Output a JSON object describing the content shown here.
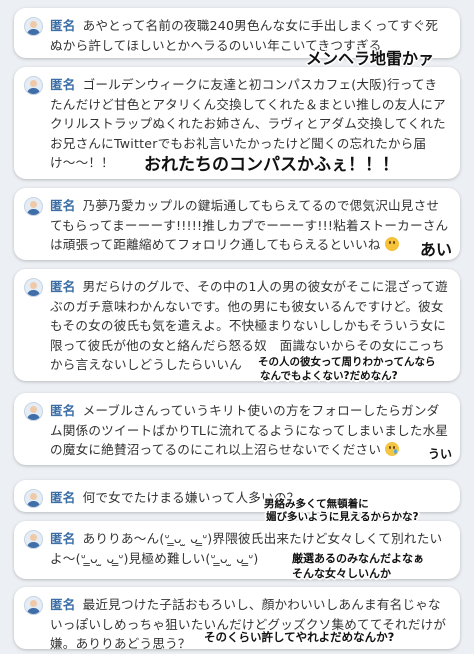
{
  "posts": [
    {
      "name": "匿名",
      "text": "あやとって名前の夜職240男色んな女に手出しまくってすぐ死ぬから許してほしいとかヘラるのいい年こいてきつすぎる",
      "caption": "メンヘラ地雷かァ"
    },
    {
      "name": "匿名",
      "text": "ゴールデンウィークに友達と初コンパスカフェ(大阪)行ってきたんだけど甘色とアタリくん交換してくれた＆まとい推しの友人にアクリルストラップぬくれたお姉さん、ラヴィとアダム交換してくれたお兄さんにTwitterでもお礼言いたかったけど聞くの忘れたから届け〜〜！！",
      "caption": "おれたちのコンパスかふぇ！！！"
    },
    {
      "name": "匿名",
      "text": "乃夢乃愛カップルの鍵垢通してもらえてるので偲気沢山見させてもらってまーーーす!!!!!推しカプでーーーす!!!粘着ストーカーさんは頑張って距離縮めてフォロリク通してもらえるといいね",
      "caption": "あい"
    },
    {
      "name": "匿名",
      "text": "男だらけのグルで、その中の1人の男の彼女がそこに混ざって遊ぶのガチ意味わかんないです。他の男にも彼女いるんですけど。彼女もその女の彼氏も気を遣えよ。不快極まりないししかもそういう女に限って彼氏が他の女と絡んだら怒る奴　面識ないからその女にこっちから言えないしどうしたらいいん",
      "caption": "その人の彼女って周りわかってんならなんでもよくない?だめなん?"
    },
    {
      "name": "匿名",
      "text": "メーブルさんっていうキリト使いの方をフォローしたらガンダム関係のツイートばかりTLに流れてるようになってしまいました水星の魔女に絶賛沼ってるのにこれ以上沼らせないでください",
      "caption": "うい"
    },
    {
      "name": "匿名",
      "text": "何で女でたけまる嫌いって人多いの？",
      "caption": "男絡み多くて無頓着に媚び多いように見えるからかな?"
    },
    {
      "name": "匿名",
      "text": "ありりあ〜ん(ᐡ ̳ᴗ ̫ ᴗ ̳ᐡ)界隈彼氏出来たけど女々しくて別れたいよ〜(ᐡ ̳ᴗ ̫ ᴗ ̳ᐡ)見極め難しい(ᐡ ̳ᴗ ̫ ᴗ ̳ᐡ)",
      "caption": "厳選あるのみなんだよなぁそんな女々しいんか"
    },
    {
      "name": "匿名",
      "text": "最近見つけた子話おもろいし、顔かわいいしあんま有名じゃないっぽいしめっちゃ狙いたいんだけどグッズクソ集めててそれだけが嫌。ありりあどう思う？",
      "caption": "そのくらい許してやれよだめなんか?"
    }
  ],
  "captions": {
    "c0": "メンヘラ地雷かァ",
    "c1": "おれたちのコンパスかふぇ！！！",
    "c2": "あい",
    "c3a": "その人の彼女って周りわかってんなら",
    "c3b": "なんでもよくない?だめなん?",
    "c4": "うい",
    "c5a": "男絡み多くて無頓着に",
    "c5b": "媚び多いように見えるからかな?",
    "c6a": "厳選あるのみなんだよなぁ",
    "c6b": "そんな女々しいんか",
    "c7": "そのくらい許してやれよだめなんか?"
  },
  "icons": {
    "avatar": "user-avatar-icon",
    "smile": "smiling-emoji-icon",
    "sad": "sad-tear-emoji-icon"
  },
  "colors": {
    "name": "#3a6ea5",
    "background": "#eceff3",
    "card": "#ffffff"
  }
}
